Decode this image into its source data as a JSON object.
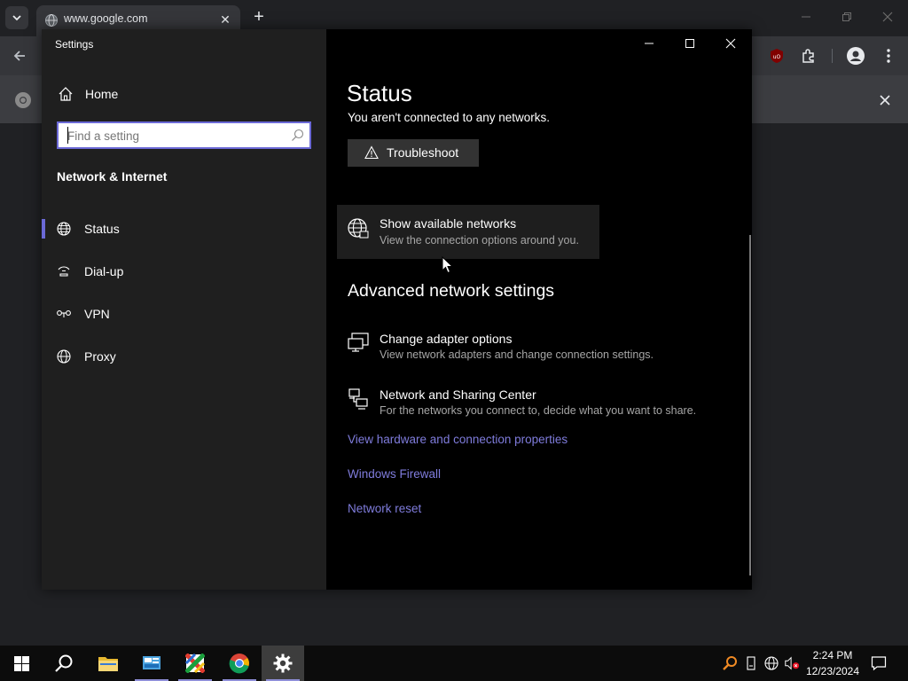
{
  "browser": {
    "tab_title": "www.google.com",
    "new_tab_symbol": "+",
    "close_symbol": "✕"
  },
  "settings": {
    "app_title": "Settings",
    "home_label": "Home",
    "search_placeholder": "Find a setting",
    "section_heading": "Network & Internet",
    "nav_items": [
      {
        "label": "Status",
        "icon": "globe-icon",
        "selected": true
      },
      {
        "label": "Dial-up",
        "icon": "dialup-icon",
        "selected": false
      },
      {
        "label": "VPN",
        "icon": "vpn-icon",
        "selected": false
      },
      {
        "label": "Proxy",
        "icon": "globe-icon",
        "selected": false
      }
    ],
    "content": {
      "page_title": "Status",
      "not_connected_text": "You aren't connected to any networks.",
      "troubleshoot_label": "Troubleshoot",
      "show_networks": {
        "title": "Show available networks",
        "subtitle": "View the connection options around you."
      },
      "advanced_heading": "Advanced network settings",
      "advanced_items": [
        {
          "title": "Change adapter options",
          "subtitle": "View network adapters and change connection settings."
        },
        {
          "title": "Network and Sharing Center",
          "subtitle": "For the networks you connect to, decide what you want to share."
        }
      ],
      "links": [
        "View hardware and connection properties",
        "Windows Firewall",
        "Network reset"
      ]
    }
  },
  "taskbar": {
    "time": "2:24 PM",
    "date": "12/23/2024",
    "apps": [
      "start-button",
      "search-button",
      "file-explorer",
      "control-panel",
      "app-x",
      "chrome",
      "settings"
    ]
  },
  "colors": {
    "accent": "#6b69d6",
    "link": "#7f7cdc",
    "nav_bg": "#1f1f1f",
    "content_bg": "#000000"
  }
}
